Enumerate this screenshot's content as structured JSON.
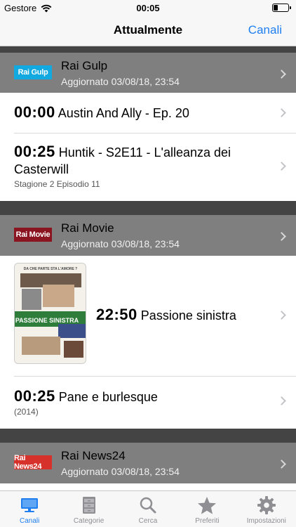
{
  "status": {
    "carrier": "Gestore",
    "time": "00:05",
    "battery_level": 0.3
  },
  "nav": {
    "title": "Attualmente",
    "right_button": "Canali"
  },
  "channels": [
    {
      "logo": "Rai Gulp",
      "name": "Rai Gulp",
      "updated": "Aggiornato 03/08/18, 23:54",
      "programs": [
        {
          "time": "00:00",
          "title": "Austin And Ally - Ep. 20",
          "subtitle": ""
        },
        {
          "time": "00:25",
          "title": "Huntik - S2E11 - L'alleanza dei Casterwill",
          "subtitle": "Stagione 2 Episodio 11"
        }
      ]
    },
    {
      "logo": "Rai Movie",
      "name": "Rai Movie",
      "updated": "Aggiornato 03/08/18, 23:54",
      "programs": [
        {
          "time": "22:50",
          "title": "Passione sinistra",
          "subtitle": "",
          "poster_tagline": "DA CHE PARTE STA L'AMORE ?",
          "poster_title": "PASSIONE SINISTRA"
        },
        {
          "time": "00:25",
          "title": "Pane e burlesque",
          "subtitle": "(2014)"
        }
      ]
    },
    {
      "logo": "Rai News24",
      "name": "Rai News24",
      "updated": "Aggiornato 03/08/18, 23:54",
      "programs": []
    }
  ],
  "tabs": [
    {
      "label": "Canali",
      "icon": "tv-icon",
      "active": true
    },
    {
      "label": "Categorie",
      "icon": "cabinet-icon",
      "active": false
    },
    {
      "label": "Cerca",
      "icon": "search-icon",
      "active": false
    },
    {
      "label": "Preferiti",
      "icon": "star-icon",
      "active": false
    },
    {
      "label": "Impostazioni",
      "icon": "gear-icon",
      "active": false
    }
  ],
  "colors": {
    "accent": "#1f7ff0",
    "header_bg": "#7f7f7f",
    "separator": "#444444",
    "inactive": "#8e8e93"
  }
}
